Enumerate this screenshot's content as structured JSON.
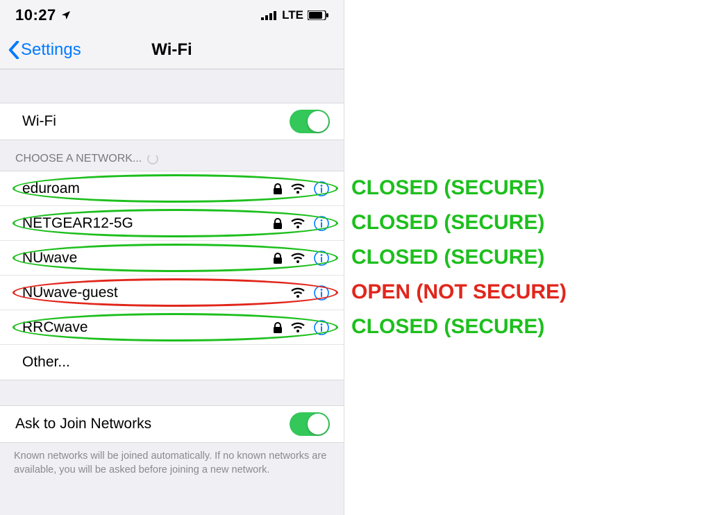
{
  "status_bar": {
    "time": "10:27",
    "network_text": "LTE"
  },
  "nav": {
    "back_label": "Settings",
    "title": "Wi-Fi"
  },
  "wifi_toggle_row": {
    "label": "Wi-Fi",
    "on": true
  },
  "section_choose": "CHOOSE A NETWORK...",
  "networks": [
    {
      "name": "eduroam",
      "secure": true,
      "annotation": "CLOSED (SECURE)",
      "color": "#1dbf1d"
    },
    {
      "name": "NETGEAR12-5G",
      "secure": true,
      "annotation": "CLOSED (SECURE)",
      "color": "#1dbf1d"
    },
    {
      "name": "NUwave",
      "secure": true,
      "annotation": "CLOSED (SECURE)",
      "color": "#1dbf1d"
    },
    {
      "name": "NUwave-guest",
      "secure": false,
      "annotation": "OPEN (NOT SECURE)",
      "color": "#e1261c"
    },
    {
      "name": "RRCwave",
      "secure": true,
      "annotation": "CLOSED (SECURE)",
      "color": "#1dbf1d"
    }
  ],
  "other_label": "Other...",
  "ask_join_row": {
    "label": "Ask to Join Networks",
    "on": true
  },
  "footer": "Known networks will be joined automatically. If no known networks are available, you will be asked before joining a new network.",
  "colors": {
    "ios_blue": "#007aff",
    "ios_green": "#34c759",
    "secure_green": "#1dbf1d",
    "open_red": "#e1261c"
  }
}
